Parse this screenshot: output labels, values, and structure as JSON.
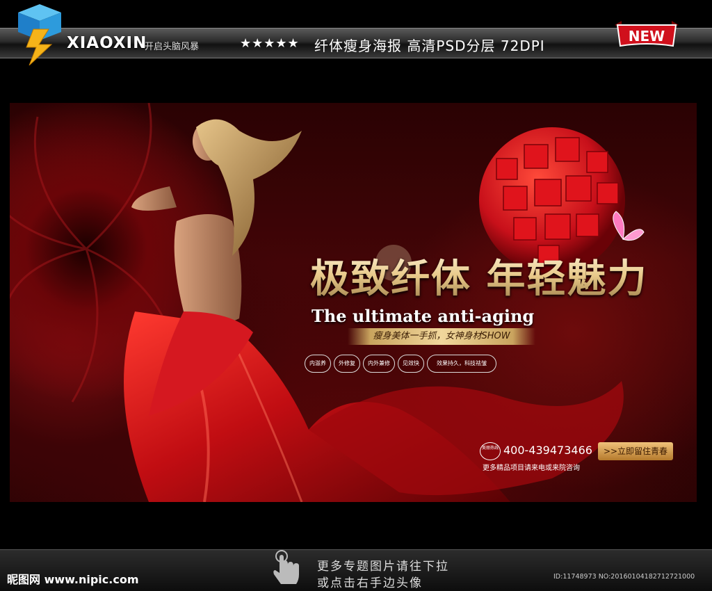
{
  "header": {
    "brand": "XIAOXIN",
    "brand_sub": "开启头脑风暴",
    "stars": "★★★★★",
    "info": "纤体瘦身海报   高清PSD分层   72DPI",
    "new_badge": "NEW"
  },
  "poster": {
    "title_cn": "极致纤体 年轻魅力",
    "title_en": "The ultimate anti-aging",
    "slogan": "瘦身美体一手抓，女神身材SHOW",
    "features": [
      "内滋养",
      "外修复",
      "内外兼修",
      "见效快",
      "效果持久，科技祛皱"
    ],
    "phone_tag": "美丽热线",
    "phone": "400-439473466",
    "cta": ">>立即留住青春",
    "consult": "更多精品项目请来电或来院咨询"
  },
  "footer": {
    "site": "昵图网 www.nipic.com",
    "tip_line1": "更多专题图片请往下拉",
    "tip_line2": "或点击右手边头像",
    "image_id": "ID:11748973 NO:20160104182712721000"
  },
  "colors": {
    "accent_red": "#c8101a",
    "gold": "#e8c98a",
    "badge_red": "#d0101c"
  },
  "icons": [
    "cube-logo-icon",
    "hand-pointer-icon",
    "butterfly-icon"
  ]
}
